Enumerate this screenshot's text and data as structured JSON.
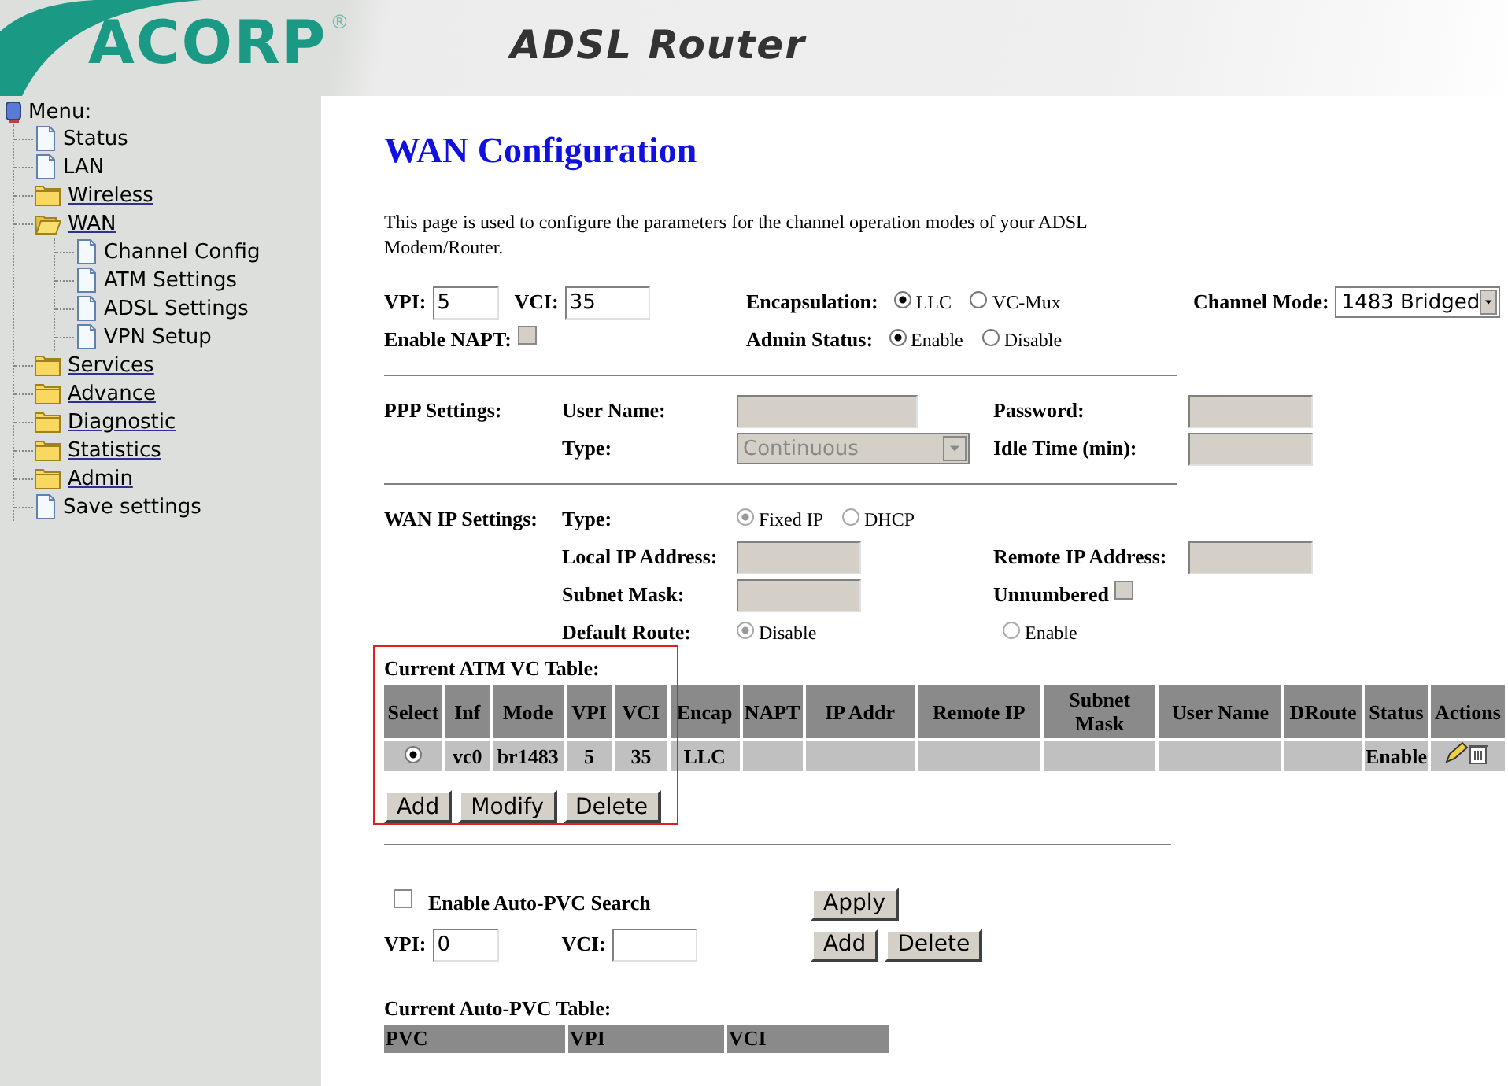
{
  "header": {
    "logo": "ACORP",
    "logo_mark": "®",
    "title": "ADSL Router"
  },
  "menu": {
    "title": "Menu:",
    "items": [
      {
        "label": "Status",
        "kind": "page"
      },
      {
        "label": "LAN",
        "kind": "page"
      },
      {
        "label": "Wireless",
        "kind": "folder",
        "expanded": false
      },
      {
        "label": "WAN",
        "kind": "folder",
        "expanded": true,
        "children": [
          {
            "label": "Channel Config",
            "kind": "page"
          },
          {
            "label": "ATM Settings",
            "kind": "page"
          },
          {
            "label": "ADSL Settings",
            "kind": "page"
          },
          {
            "label": "VPN Setup",
            "kind": "page"
          }
        ]
      },
      {
        "label": "Services",
        "kind": "folder",
        "expanded": false
      },
      {
        "label": "Advance",
        "kind": "folder",
        "expanded": false
      },
      {
        "label": "Diagnostic",
        "kind": "folder",
        "expanded": false
      },
      {
        "label": "Statistics",
        "kind": "folder",
        "expanded": false
      },
      {
        "label": "Admin",
        "kind": "folder",
        "expanded": false
      },
      {
        "label": "Save settings",
        "kind": "page"
      }
    ]
  },
  "page": {
    "title": "WAN Configuration",
    "description": "This page is used to configure the parameters for the channel operation modes of your ADSL Modem/Router."
  },
  "channel": {
    "vpi_label": "VPI:",
    "vpi": "5",
    "vci_label": "VCI:",
    "vci": "35",
    "encapsulation_label": "Encapsulation:",
    "encapsulation": [
      {
        "label": "LLC",
        "selected": true
      },
      {
        "label": "VC-Mux",
        "selected": false
      }
    ],
    "mode_label": "Channel Mode:",
    "mode": "1483 Bridged",
    "napt": {
      "label": "Enable NAPT:",
      "checked": false,
      "disabled": true
    },
    "admin_label": "Admin Status:",
    "admin": [
      {
        "label": "Enable",
        "selected": true
      },
      {
        "label": "Disable",
        "selected": false
      }
    ]
  },
  "ppp": {
    "heading": "PPP Settings:",
    "disabled": true,
    "user_label": "User Name:",
    "password_label": "Password:",
    "type_label": "Type:",
    "type": "Continuous",
    "idle_label": "Idle Time (min):"
  },
  "wan_ip": {
    "heading": "WAN IP Settings:",
    "disabled": true,
    "type_label": "Type:",
    "type": [
      {
        "label": "Fixed IP",
        "selected": true
      },
      {
        "label": "DHCP",
        "selected": false
      }
    ],
    "local_label": "Local IP Address:",
    "remote_label": "Remote IP Address:",
    "mask_label": "Subnet Mask:",
    "unnumbered": {
      "label": "Unnumbered",
      "checked": false
    },
    "route_label": "Default Route:",
    "route": [
      {
        "label": "Disable",
        "selected": true
      },
      {
        "label": "Enable",
        "selected": false
      }
    ]
  },
  "atm_table": {
    "title": "Current ATM VC Table:",
    "columns": [
      {
        "label": "Select",
        "kind": "select"
      },
      {
        "label": "Inf",
        "kind": "inf"
      },
      {
        "label": "Mode",
        "kind": "mode"
      },
      {
        "label": "VPI",
        "kind": "vpi"
      },
      {
        "label": "VCI",
        "kind": "vci"
      },
      {
        "label": "Encap",
        "kind": "encap"
      },
      {
        "label": "NAPT",
        "kind": "napt"
      },
      {
        "label": "IP Addr",
        "kind": "ip"
      },
      {
        "label": "Remote IP",
        "kind": "remote"
      },
      {
        "label": "Subnet Mask",
        "kind": "mask"
      },
      {
        "label": "User Name",
        "kind": "user"
      },
      {
        "label": "DRoute",
        "kind": "droute"
      },
      {
        "label": "Status",
        "kind": "status"
      },
      {
        "label": "Actions",
        "kind": "actions"
      }
    ],
    "rows": [
      {
        "selected": true,
        "inf": "vc0",
        "mode": "br1483",
        "vpi": "5",
        "vci": "35",
        "encap": "LLC",
        "status": "Enable"
      }
    ],
    "buttons": [
      "Add",
      "Modify",
      "Delete"
    ]
  },
  "auto_pvc": {
    "search": {
      "label": "Enable Auto-PVC Search",
      "checked": false
    },
    "vpi_label": "VPI:",
    "vpi": "0",
    "vci_label": "VCI:",
    "apply": "Apply",
    "buttons": [
      "Add",
      "Delete"
    ],
    "table_title": "Current Auto-PVC Table:",
    "columns": [
      "PVC",
      "VPI",
      "VCI"
    ]
  }
}
